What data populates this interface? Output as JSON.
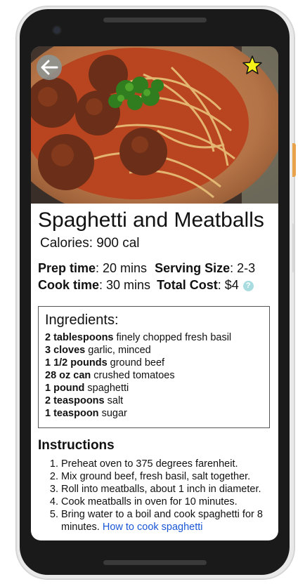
{
  "recipe": {
    "title": "Spaghetti and Meatballs",
    "calories": "Calories: 900 cal",
    "prep_label": "Prep time",
    "prep_value": ": 20 mins",
    "serving_label": "Serving Size",
    "serving_value": ": 2-3",
    "cook_label": "Cook time",
    "cook_value": ": 30 mins",
    "cost_label": "Total Cost",
    "cost_value": ": $4",
    "help_glyph": "?"
  },
  "ingredients": {
    "title": "Ingredients:",
    "items": [
      {
        "qty": "2 tablespoons",
        "text": " finely chopped fresh basil"
      },
      {
        "qty": "3 cloves",
        "text": " garlic, minced"
      },
      {
        "qty": "1 1/2 pounds",
        "text": " ground beef"
      },
      {
        "qty": "28 oz can",
        "text": " crushed tomatoes"
      },
      {
        "qty": "1 pound",
        "text": " spaghetti"
      },
      {
        "qty": "2 teaspoons",
        "text": " salt"
      },
      {
        "qty": "1 teaspoon",
        "text": " sugar"
      }
    ]
  },
  "instructions": {
    "title": "Instructions",
    "steps": [
      "Preheat oven to 375 degrees farenheit.",
      "Mix ground beef, fresh basil, salt together.",
      "Roll into meatballs, about 1 inch in diameter.",
      "Cook meatballs in oven for 10 minutes.",
      "Bring water to a boil and cook spaghetti for 8 minutes."
    ],
    "link_text": "How to cook spaghetti"
  },
  "icons": {
    "back": "back-arrow-icon",
    "favorite": "star-icon",
    "help": "help-icon"
  },
  "colors": {
    "star_fill": "#f4f218",
    "link": "#1a56d6",
    "help_badge": "#a9dce0"
  }
}
